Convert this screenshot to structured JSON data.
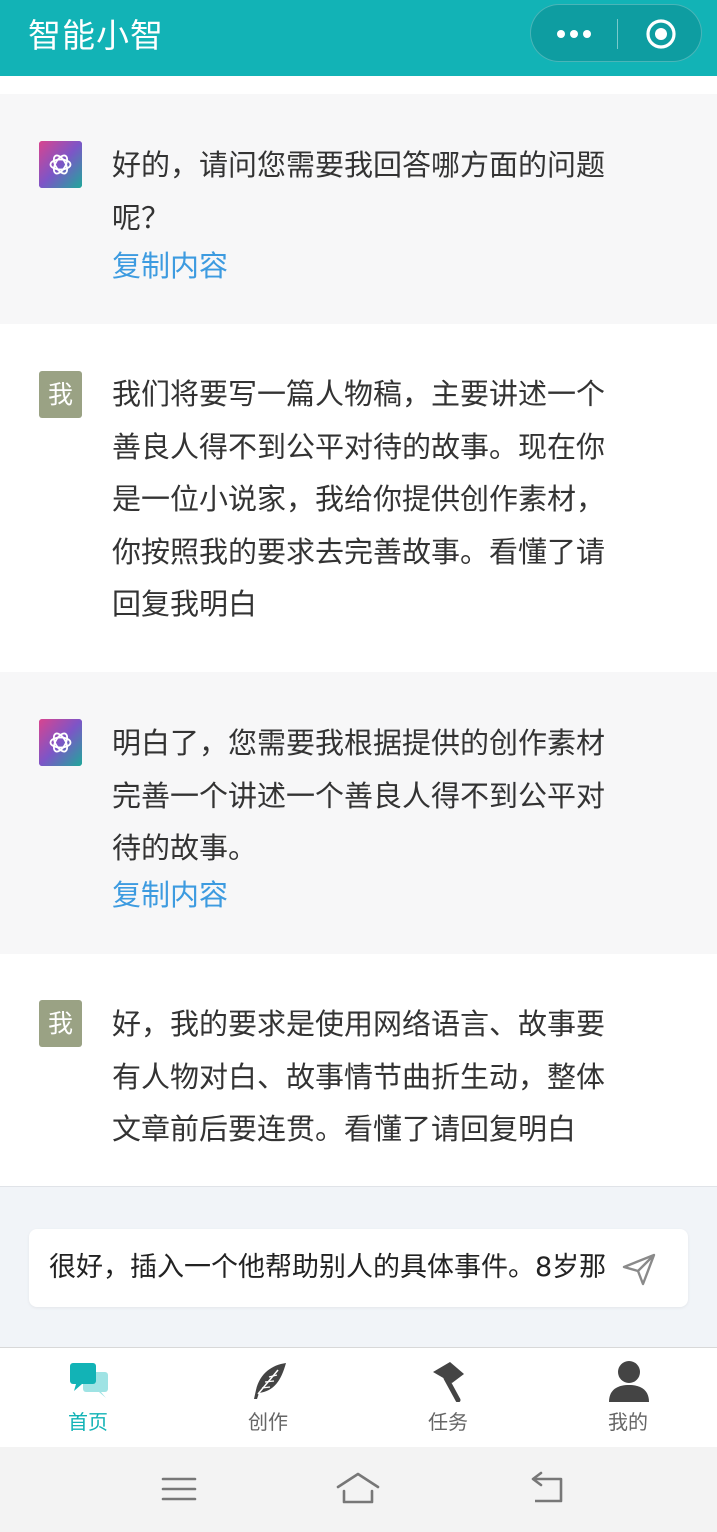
{
  "header": {
    "title": "智能小智",
    "more_icon": "more-dots-icon",
    "close_icon": "target-circle-icon"
  },
  "messages": [
    {
      "role": "bot",
      "avatar_icon": "openai-logo-icon",
      "text": "好的，请问您需要我回答哪方面的问题\n呢？",
      "copy_label": "复制内容"
    },
    {
      "role": "user",
      "avatar_label": "我",
      "text": "我们将要写一篇人物稿，主要讲述一个\n善良人得不到公平对待的故事。现在你\n是一位小说家，我给你提供创作素材，\n你按照我的要求去完善故事。看懂了请\n回复我明白"
    },
    {
      "role": "bot",
      "avatar_icon": "openai-logo-icon",
      "text": "明白了，您需要我根据提供的创作素材\n完善一个讲述一个善良人得不到公平对\n待的故事。",
      "copy_label": "复制内容"
    },
    {
      "role": "user",
      "avatar_label": "我",
      "text": "好，我的要求是使用网络语言、故事要\n有人物对白、故事情节曲折生动，整体\n文章前后要连贯。看懂了请回复明白"
    }
  ],
  "input": {
    "value": "很好，插入一个他帮助别人的具体事件。8岁那",
    "send_icon": "send-icon"
  },
  "tabbar": {
    "items": [
      {
        "label": "首页",
        "icon": "chat-bubbles-icon",
        "active": true
      },
      {
        "label": "创作",
        "icon": "feather-icon",
        "active": false
      },
      {
        "label": "任务",
        "icon": "flag-icon",
        "active": false
      },
      {
        "label": "我的",
        "icon": "person-icon",
        "active": false
      }
    ]
  },
  "system_nav": {
    "items": [
      "menu-icon",
      "home-icon",
      "back-icon"
    ]
  },
  "colors": {
    "accent": "#12b3b6",
    "link": "#3d9be0",
    "user_avatar": "#9aa284",
    "bot_bg": "#f7f7f8"
  }
}
